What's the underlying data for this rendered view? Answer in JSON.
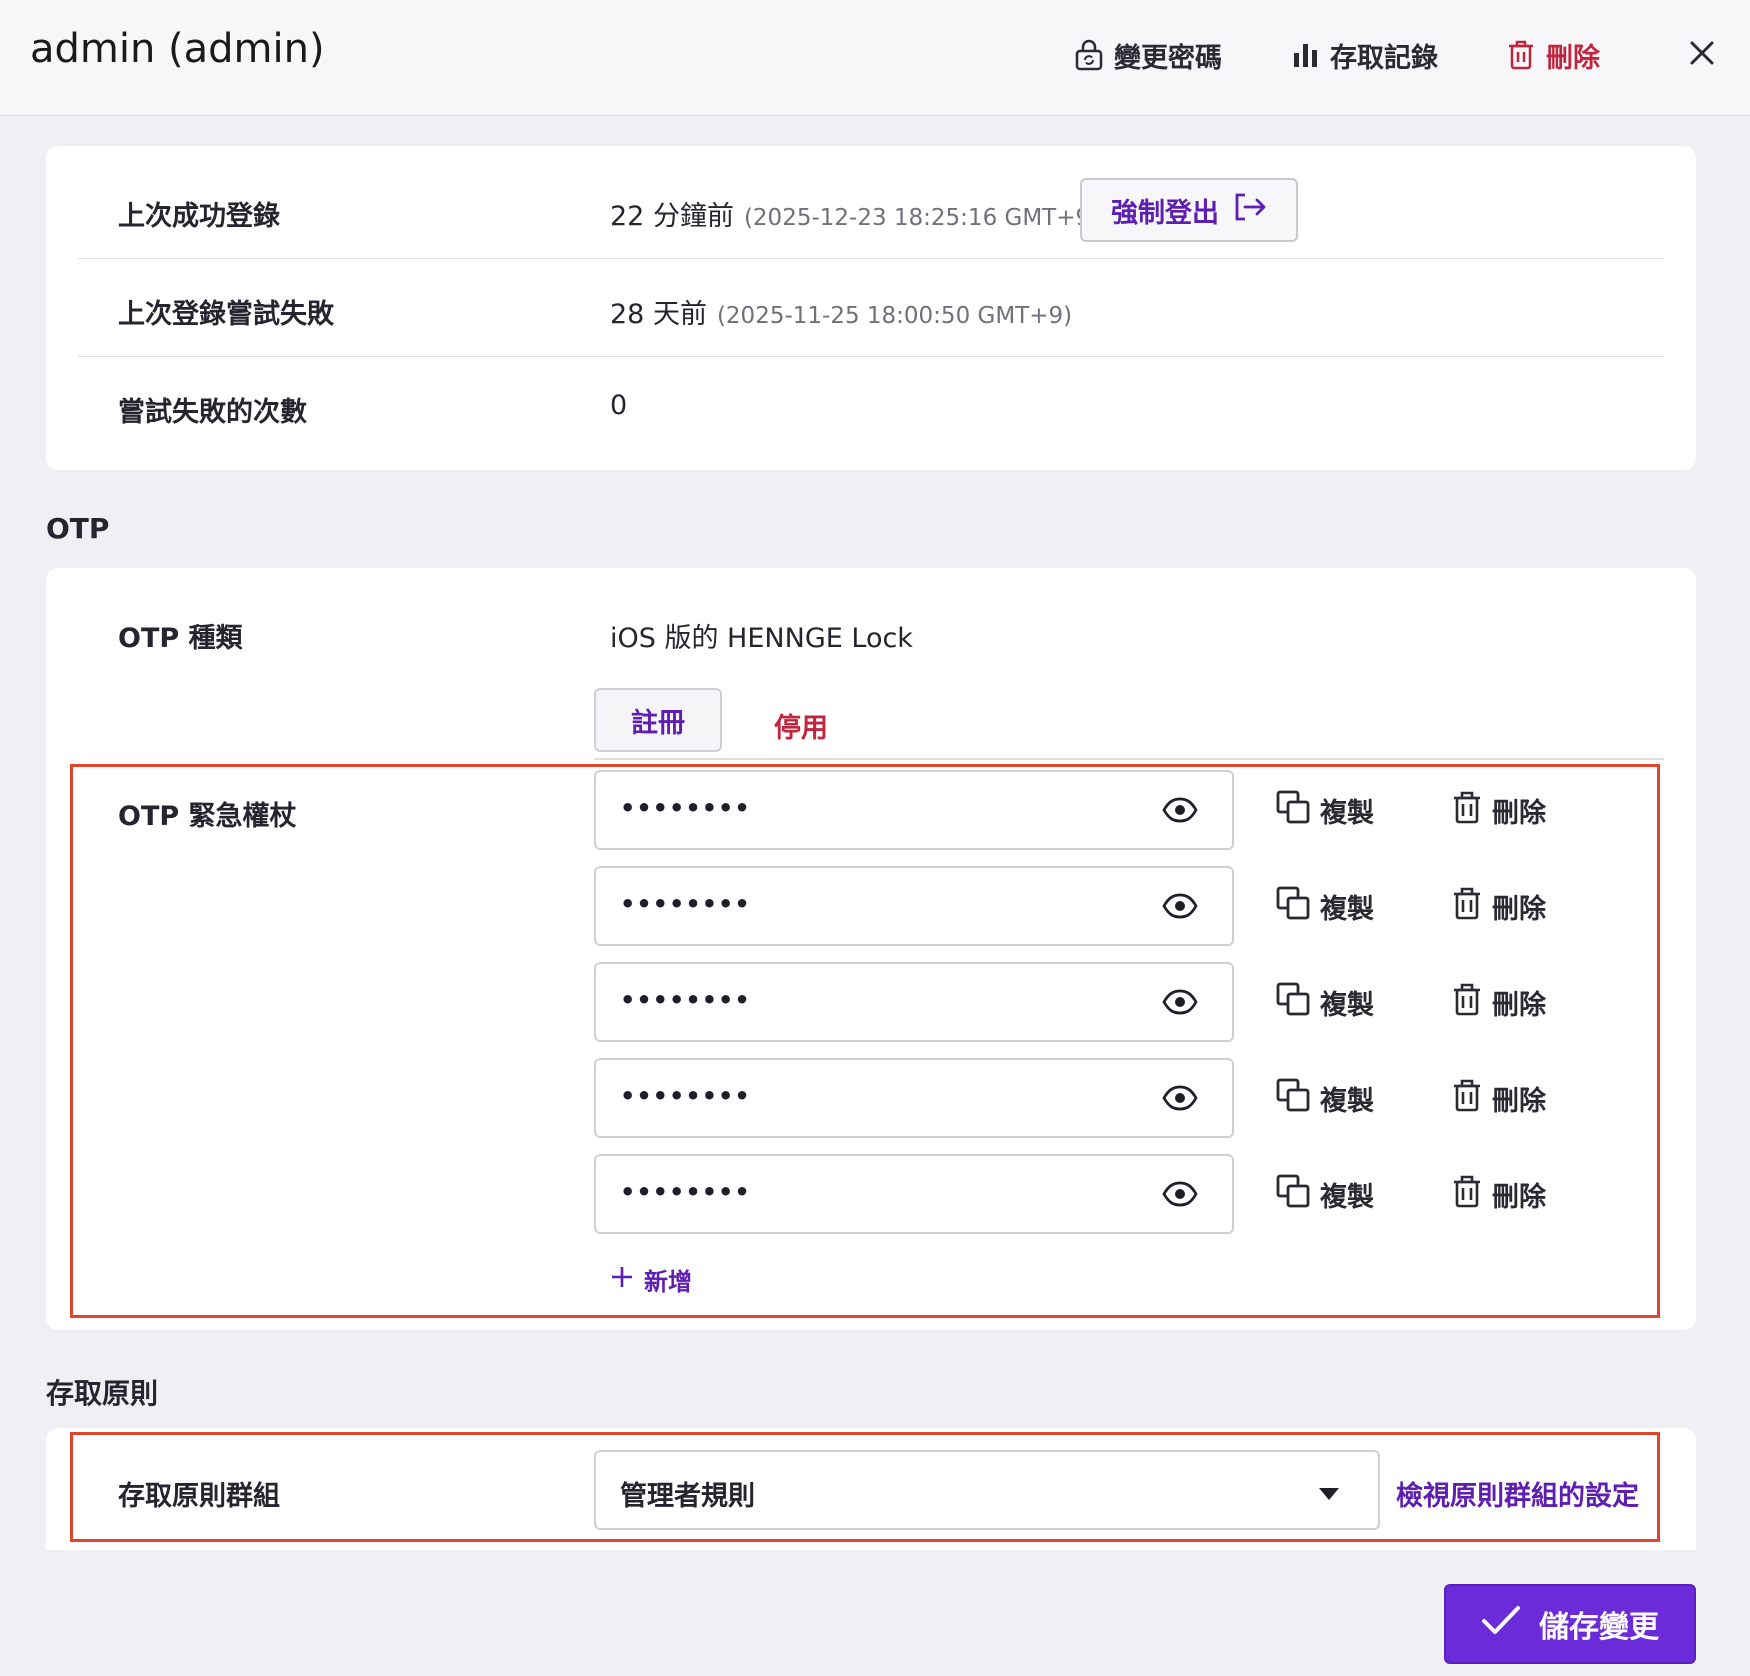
{
  "header": {
    "title": "admin (admin)",
    "change_password": "變更密碼",
    "access_log": "存取記錄",
    "delete": "刪除"
  },
  "scroll_hint": "存取記錄",
  "login_info": {
    "rows": [
      {
        "label": "上次成功登錄",
        "value": "22 分鐘前",
        "timestamp": "(2025-12-23 18:25:16 GMT+9)"
      },
      {
        "label": "上次登錄嘗試失敗",
        "value": "28 天前",
        "timestamp": "(2025-11-25 18:00:50 GMT+9)"
      },
      {
        "label": "嘗試失敗的次數",
        "value": "0"
      }
    ],
    "force_logout": "強制登出"
  },
  "otp": {
    "section_title": "OTP",
    "type_label": "OTP 種類",
    "type_value": "iOS 版的 HENNGE Lock",
    "tab_register": "註冊",
    "tab_disable": "停用",
    "emergency_label": "OTP 緊急權杖",
    "tokens": [
      {
        "value": "••••••••"
      },
      {
        "value": "••••••••"
      },
      {
        "value": "••••••••"
      },
      {
        "value": "••••••••"
      },
      {
        "value": "••••••••"
      }
    ],
    "copy_label": "複製",
    "delete_label": "刪除",
    "add_label": "新增"
  },
  "policy": {
    "section_title": "存取原則",
    "group_label": "存取原則群組",
    "group_value": "管理者規則",
    "view_link": "檢視原則群組的設定"
  },
  "save_button": "儲存變更",
  "colors": {
    "accent": "#6c2bd9",
    "link": "#5e1fb0",
    "danger": "#c0253e",
    "highlight": "#e0452e",
    "background": "#f0eff4"
  }
}
